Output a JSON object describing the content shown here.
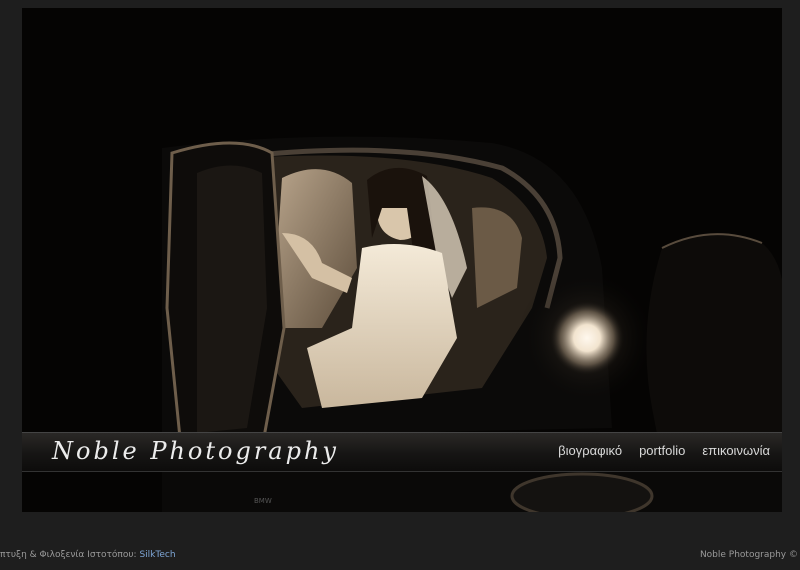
{
  "hero": {
    "image_alt": "Bride stepping out of a BMW car at night",
    "car_badge": "BMW"
  },
  "header": {
    "logo_text": "Noble Photography"
  },
  "nav": {
    "items": [
      {
        "label": "βιογραφικό"
      },
      {
        "label": "portfolio"
      },
      {
        "label": "επικοινωνία"
      }
    ]
  },
  "footer": {
    "credit_text": "πτυξη & Φιλοξενία Ιστοτόπου: ",
    "credit_link": "SilkTech",
    "copyright": "Noble Photography ©"
  },
  "colors": {
    "background": "#1e1e1e",
    "link": "#7ea6d6",
    "nav_text": "#d8d8d8"
  }
}
